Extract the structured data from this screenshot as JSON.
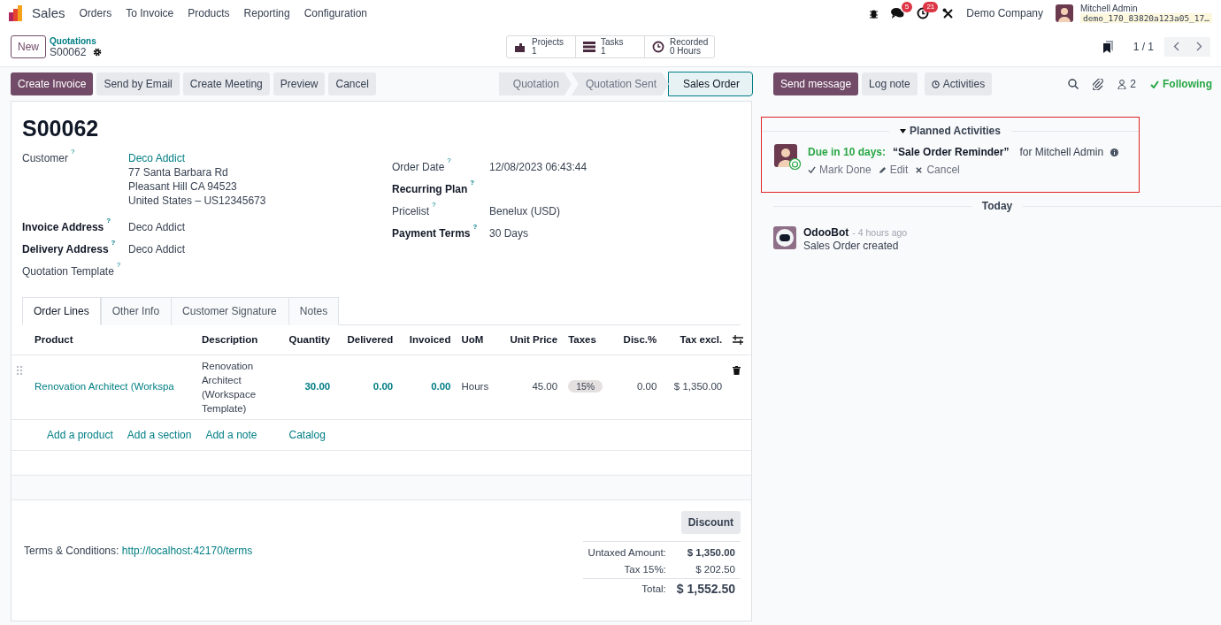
{
  "navbar": {
    "app": "Sales",
    "menu": [
      "Orders",
      "To Invoice",
      "Products",
      "Reporting",
      "Configuration"
    ],
    "messages_count": "5",
    "activities_count": "21",
    "company": "Demo Company",
    "user": "Mitchell Admin",
    "database": "demo_170_83820a123a05_17…"
  },
  "control_panel": {
    "new_button": "New",
    "breadcrumb": "Quotations",
    "record": "S00062",
    "smart_buttons": [
      {
        "label": "Projects",
        "value": "1"
      },
      {
        "label": "Tasks",
        "value": "1"
      },
      {
        "label": "Recorded",
        "value": "0 Hours"
      }
    ],
    "pager": "1 / 1"
  },
  "action_buttons": [
    {
      "label": "Create Invoice",
      "primary": true
    },
    {
      "label": "Send by Email",
      "primary": false
    },
    {
      "label": "Create Meeting",
      "primary": false
    },
    {
      "label": "Preview",
      "primary": false
    },
    {
      "label": "Cancel",
      "primary": false
    }
  ],
  "stages": [
    {
      "label": "Quotation",
      "selected": false
    },
    {
      "label": "Quotation Sent",
      "selected": false
    },
    {
      "label": "Sales Order",
      "selected": true
    }
  ],
  "form": {
    "title": "S00062",
    "left_fields": [
      {
        "label": "Customer",
        "bold": false,
        "help": "?",
        "value": "Deco Addict",
        "link": true,
        "address": [
          "77 Santa Barbara Rd",
          "Pleasant Hill CA 94523",
          "United States – US12345673"
        ]
      },
      {
        "label": "Invoice Address",
        "bold": true,
        "help": "?",
        "value": "Deco Addict",
        "link": false
      },
      {
        "label": "Delivery Address",
        "bold": true,
        "help": "?",
        "value": "Deco Addict",
        "link": false
      },
      {
        "label": "Quotation Template",
        "bold": false,
        "help": "?"
      }
    ],
    "right_fields": [
      {
        "label": "Order Date",
        "bold": false,
        "help": "?",
        "value": "12/08/2023 06:43:44",
        "link": false
      },
      {
        "label": "Recurring Plan",
        "bold": true,
        "help": "?"
      },
      {
        "label": "Pricelist",
        "bold": false,
        "help": "?",
        "value": "Benelux (USD)",
        "link": false
      },
      {
        "label": "Payment Terms",
        "bold": true,
        "help": "?",
        "value": "30 Days",
        "link": false
      }
    ],
    "tabs": [
      {
        "label": "Order Lines",
        "selected": true
      },
      {
        "label": "Other Info",
        "selected": false
      },
      {
        "label": "Customer Signature",
        "selected": false
      },
      {
        "label": "Notes",
        "selected": false
      }
    ],
    "table": {
      "columns": [
        "Product",
        "Description",
        "Quantity",
        "Delivered",
        "Invoiced",
        "UoM",
        "Unit Price",
        "Taxes",
        "Disc.%",
        "Tax excl."
      ],
      "rows": [
        {
          "product": "Renovation Architect (Workspa",
          "description": "Renovation Architect (Workspace Template)",
          "quantity": "30.00",
          "delivered": "0.00",
          "invoiced": "0.00",
          "uom": "Hours",
          "unit_price": "45.00",
          "taxes": "15%",
          "discount": "0.00",
          "subtotal": "$ 1,350.00"
        }
      ],
      "add_links": [
        "Add a product",
        "Add a section",
        "Add a note",
        "Catalog"
      ]
    },
    "discount_button": "Discount",
    "terms": {
      "label": "Terms & Conditions:",
      "link": "http://localhost:42170/terms"
    },
    "totals": [
      {
        "kind": "untaxed",
        "label": "Untaxed Amount:",
        "value": "$ 1,350.00"
      },
      {
        "kind": "tax",
        "label": "Tax 15%:",
        "value": "$ 202.50"
      },
      {
        "kind": "total",
        "label": "Total:",
        "value": "$ 1,552.50"
      }
    ]
  },
  "chatter": {
    "buttons": [
      {
        "label": "Send message",
        "primary": true
      },
      {
        "label": "Log note",
        "primary": false
      },
      {
        "label": "Activities",
        "primary": false
      }
    ],
    "followers_count": "2",
    "following": "Following",
    "planned": {
      "header": "Planned Activities",
      "activities": [
        {
          "due": "Due in 10 days:",
          "summary": "“Sale Order Reminder”",
          "assignee": "for Mitchell Admin",
          "actions": [
            "Mark Done",
            "Edit",
            "Cancel"
          ]
        }
      ]
    },
    "separator": "Today",
    "messages": [
      {
        "author": "OdooBot",
        "time": "- 4 hours ago",
        "body": "Sales Order created"
      }
    ]
  }
}
